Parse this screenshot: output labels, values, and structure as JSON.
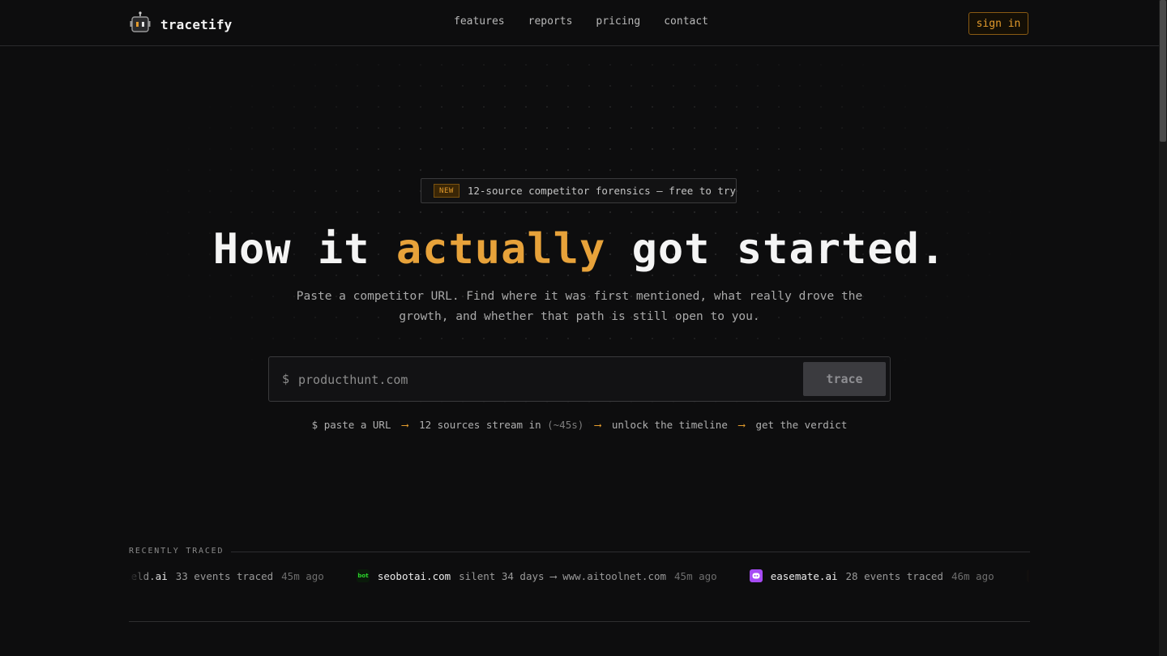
{
  "header": {
    "brand": "tracetify",
    "nav": [
      "features",
      "reports",
      "pricing",
      "contact"
    ],
    "signin_label": "sign in"
  },
  "hero": {
    "badge_tag": "NEW",
    "badge_text": "12-source competitor forensics — free to try",
    "headline_pre": "How it ",
    "headline_accent": "actually",
    "headline_post": " got started.",
    "subtitle": "Paste a competitor URL. Find where it was first mentioned, what really drove the growth, and whether that path is still open to you.",
    "prompt_symbol": "$",
    "input_placeholder": "producthunt.com",
    "trace_label": "trace",
    "steps": {
      "s1": "$ paste a URL",
      "s2": "12 sources stream in",
      "s2_note": "(~45s)",
      "s3": "unlock the timeline",
      "s4": "get the verdict",
      "arrow": "⟶"
    }
  },
  "recent": {
    "label": "RECENTLY TRACED",
    "items": [
      {
        "domain": "sfield.ai",
        "detail": "33 events traced",
        "time": "45m ago",
        "icon": "none"
      },
      {
        "domain": "seobotai.com",
        "detail": "silent 34 days ⟶ www.aitoolnet.com",
        "time": "45m ago",
        "icon": "bot-icon"
      },
      {
        "domain": "easemate.ai",
        "detail": "28 events traced",
        "time": "46m ago",
        "icon": "easemate-icon"
      }
    ]
  },
  "colors": {
    "accent": "#e7a23a",
    "background": "#0d0d0e",
    "bot_icon_green": "#2bd62b",
    "easemate_purple": "#a64bf4"
  }
}
